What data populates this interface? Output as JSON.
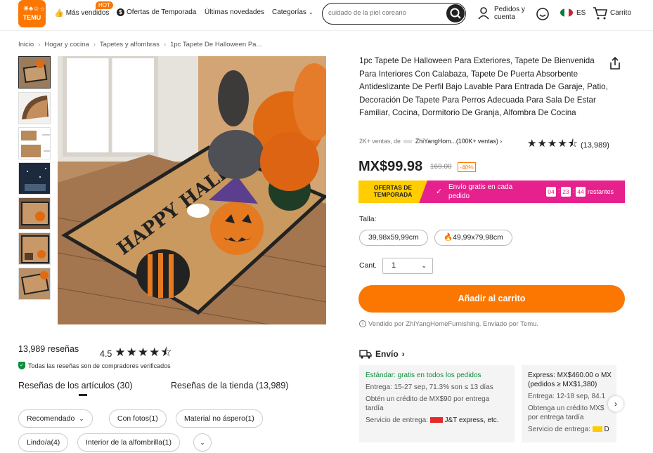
{
  "header": {
    "logo_text": "TEMU",
    "nav": [
      {
        "label": "Más vendidos",
        "badge": "HOT"
      },
      {
        "label": "Ofertas de Temporada"
      },
      {
        "label": "Últimas novedades"
      },
      {
        "label": "Categorías"
      }
    ],
    "search_placeholder": "cuidado de la piel coreano",
    "orders": "Pedidos y cuenta",
    "lang": "ES",
    "cart": "Carrito"
  },
  "breadcrumb": [
    "Inicio",
    "Hogar y cocina",
    "Tapetes y alfombras",
    "1pc Tapete De Halloween Pa..."
  ],
  "image": {
    "mat_text": "HAPPY HALLOWEEN"
  },
  "product": {
    "title": "1pc Tapete De Halloween Para Exteriores, Tapete De Bienvenida Para Interiores Con Calabaza, Tapete De Puerta Absorbente Antideslizante De Perfil Bajo Lavable Para Entrada De Garaje, Patio, Decoración De Tapete Para Perros Adecuada Para Sala De Estar Familiar, Cocina, Dormitorio De Granja, Alfombra De Cocina",
    "sales": "2K+ ventas, de",
    "store": "ZhiYangHom...(100K+ ventas)",
    "rating_count": "(13,989)",
    "rating": 4.5,
    "price": "MX$99.98",
    "old_price": "169.00",
    "discount": "-40%",
    "sold_by": "Vendido por ZhiYangHomeFurnishing. Enviado por Temu."
  },
  "promo": {
    "label": "OFERTAS DE TEMPORADA",
    "shipping": "Envío gratis en cada pedido",
    "countdown": [
      "04",
      "23",
      "44"
    ],
    "remaining": "restantes"
  },
  "options": {
    "size_label": "Talla:",
    "sizes": [
      "39,98x59,99cm",
      "49,99x79,98cm"
    ],
    "qty_label": "Cant.",
    "qty_value": "1",
    "add_to_cart": "Añadir al carrito"
  },
  "shipping": {
    "title": "Envío",
    "standard": {
      "name": "Estándar: gratis en todos los pedidos",
      "delivery": "Entrega: 15-27 sep, 71.3% son ≤ 13 días",
      "credit": "Obtén un crédito de MX$90 por entrega tardía",
      "service": "Servicio de entrega:",
      "carrier": "J&T express, etc."
    },
    "express": {
      "name": "Express: MX$460.00 o MX",
      "condition": "(pedidos ≥ MX$1,380)",
      "delivery": "Entrega: 12-18 sep, 84.1",
      "credit": "Obtenga un crédito MX$",
      "credit2": "por entrega tardía",
      "service": "Servicio de entrega:",
      "carrier": "D"
    }
  },
  "reviews": {
    "count": "13,989 reseñas",
    "score": "4.5",
    "verified": "Todas las reseñas son de compradores verificados",
    "tab_items": "Reseñas de los artículos (30)",
    "tab_store": "Reseñas de la tienda (13,989)",
    "filters": [
      "Recomendado",
      "Con fotos(1)",
      "Material no áspero(1)",
      "Lindo/a(4)",
      "Interior de la alfombrilla(1)"
    ]
  },
  "colors": {
    "accent": "#fb7701",
    "promo_pink": "#e6218d",
    "promo_yellow": "#ffcd00",
    "verified_green": "#0a8f3c"
  }
}
